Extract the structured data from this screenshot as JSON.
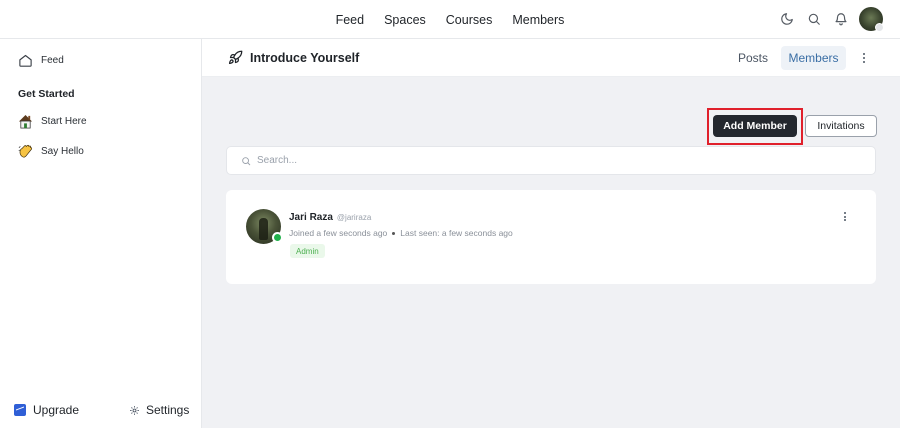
{
  "top_nav": {
    "items": [
      "Feed",
      "Spaces",
      "Courses",
      "Members"
    ]
  },
  "sidebar": {
    "feed_label": "Feed",
    "section_heading": "Get Started",
    "items": [
      {
        "label": "Start Here",
        "icon": "house-emoji-icon"
      },
      {
        "label": "Say Hello",
        "icon": "waving-hand-emoji-icon"
      }
    ],
    "upgrade_label": "Upgrade",
    "settings_label": "Settings"
  },
  "header": {
    "space_title": "Introduce Yourself",
    "tabs": [
      {
        "label": "Posts",
        "active": false
      },
      {
        "label": "Members",
        "active": true
      }
    ]
  },
  "main": {
    "add_member_label": "Add Member",
    "invitations_label": "Invitations",
    "search_placeholder": "Search...",
    "members": [
      {
        "name": "Jari Raza",
        "handle": "@jariraza",
        "joined": "Joined a few seconds ago",
        "last_seen": "Last seen: a few seconds ago",
        "role": "Admin",
        "online": true
      }
    ]
  },
  "colors": {
    "accent_blue": "#3a6ea5",
    "primary_button": "#23272e",
    "highlight_box": "#e0202b",
    "online": "#22b14c",
    "admin_badge_text": "#4caf50",
    "content_bg": "#f0f1f4"
  }
}
